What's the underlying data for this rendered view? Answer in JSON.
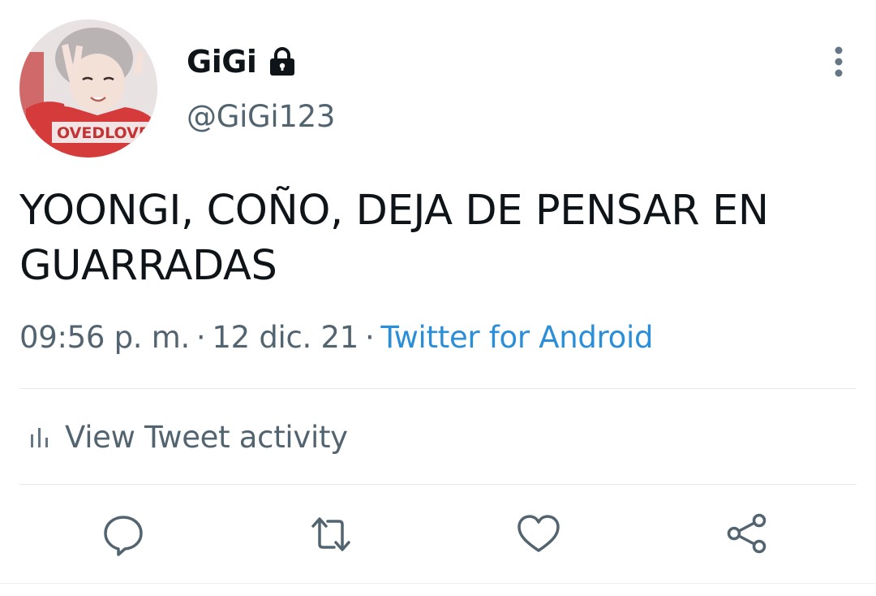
{
  "tweet": {
    "display_name": "GiGi",
    "handle": "@GiGi123",
    "text": "YOONGI, COÑO, DEJA DE PENSAR EN GUARRADAS",
    "time": "09:56 p. m.",
    "date": "12 dic. 21",
    "separator": "·",
    "source": "Twitter for Android",
    "avatar_shirt_text": "OVEDLOVE"
  },
  "activity": {
    "label": "View Tweet activity"
  },
  "icons": {
    "lock": "lock-icon",
    "more": "more-vertical-icon",
    "activity": "bar-chart-icon",
    "reply": "reply-icon",
    "retweet": "retweet-icon",
    "like": "heart-icon",
    "share": "share-icon"
  },
  "colors": {
    "text": "#0f1419",
    "secondary": "#536471",
    "link": "#2a8fd8",
    "divider": "#e6e9eb"
  }
}
